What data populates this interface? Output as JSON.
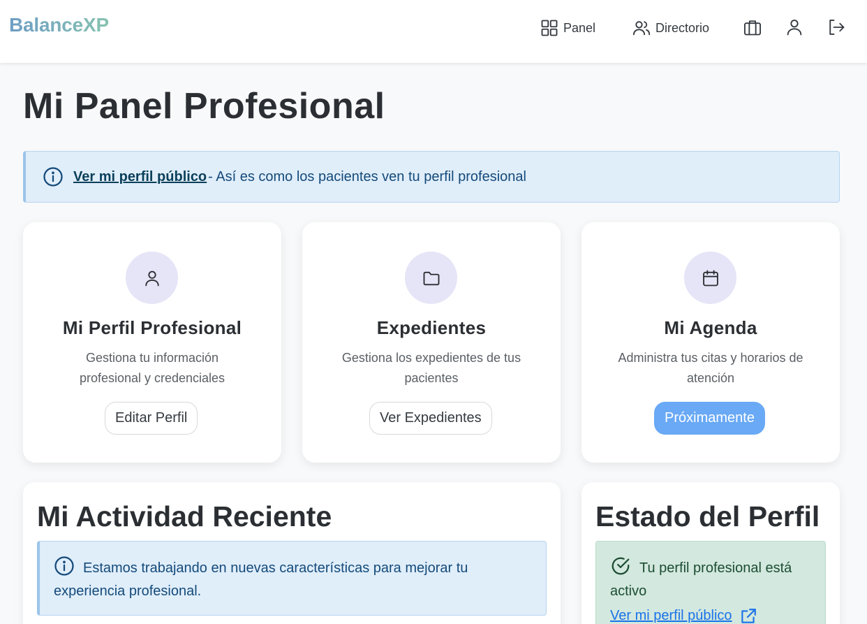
{
  "brand": "BalanceXP",
  "nav": {
    "panel_label": "Panel",
    "directory_label": "Directorio",
    "icons": [
      "briefcase-icon",
      "user-icon",
      "logout-icon"
    ]
  },
  "page_title": "Mi Panel Profesional",
  "public_profile_alert": {
    "link_text": "Ver mi perfil público ",
    "text": "- Así es como los pacientes ven tu perfil profesional"
  },
  "cards": [
    {
      "icon": "user-icon",
      "title": "Mi Perfil Profesional",
      "text": "Gestiona tu información profesional y credenciales",
      "button": "Editar Perfil"
    },
    {
      "icon": "folder-icon",
      "title": "Expedientes",
      "text": "Gestiona los expedientes de tus pacientes",
      "button": "Ver Expedientes"
    },
    {
      "icon": "calendar-icon",
      "title": "Mi Agenda",
      "text": "Administra tus citas y horarios de atención",
      "button": "Próximamente"
    }
  ],
  "activity": {
    "title": "Mi Actividad Reciente",
    "alert_text": "Estamos trabajando en nuevas características para mejorar tu experiencia profesional."
  },
  "profile_status": {
    "title": "Estado del Perfil",
    "status_text": "Tu perfil profesional está activo",
    "link_text": "Ver mi perfil público"
  },
  "colors": {
    "brand_gradient_start": "#6d9dc5",
    "brand_gradient_end": "#86c3b0",
    "info_bg": "#e0eefa",
    "success_bg": "#d3e8de",
    "primary_button": "#69a9f5",
    "icon_circle": "#e5e5f7"
  }
}
